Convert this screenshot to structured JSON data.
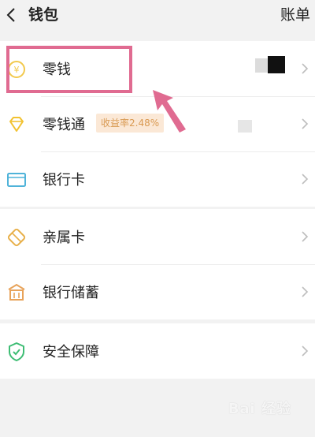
{
  "header": {
    "title": "钱包",
    "bill_label": "账单"
  },
  "group1": {
    "items": [
      {
        "label": "零钱"
      },
      {
        "label": "零钱通",
        "badge": "收益率2.48%"
      },
      {
        "label": "银行卡"
      }
    ]
  },
  "group2": {
    "items": [
      {
        "label": "亲属卡"
      },
      {
        "label": "银行储蓄"
      }
    ]
  },
  "group3": {
    "items": [
      {
        "label": "安全保障"
      }
    ]
  },
  "watermark": {
    "text": "Bai 经验"
  },
  "colors": {
    "highlight": "#e06b91",
    "coin_yellow": "#f2c94c",
    "diamond_yellow": "#f2c230",
    "card_teal": "#4fb3d9",
    "shield_green": "#3ebd74",
    "badge_bg": "#fbe8d6",
    "badge_text": "#d99a52"
  },
  "icons": [
    "back-arrow-icon",
    "coin-icon",
    "diamond-icon",
    "bank-card-icon",
    "family-card-icon",
    "bank-deposit-icon",
    "shield-icon",
    "chevron-right-icon"
  ]
}
